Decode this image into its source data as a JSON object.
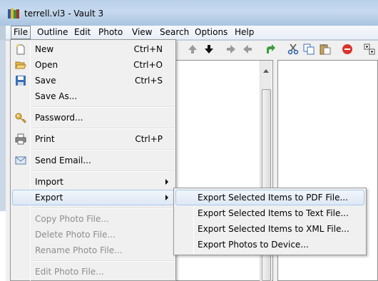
{
  "window": {
    "title": "terrell.vl3 - Vault 3"
  },
  "menubar": {
    "items": [
      "File",
      "Outline",
      "Edit",
      "Photo",
      "View",
      "Search",
      "Options",
      "Help"
    ]
  },
  "file_menu": {
    "items": [
      {
        "label": "New",
        "shortcut": "Ctrl+N",
        "icon": "new-file-icon"
      },
      {
        "label": "Open",
        "shortcut": "Ctrl+O",
        "icon": "open-folder-icon"
      },
      {
        "label": "Save",
        "shortcut": "Ctrl+S",
        "icon": "save-disk-icon"
      },
      {
        "label": "Save As...",
        "shortcut": ""
      },
      {
        "label": "Password...",
        "shortcut": "",
        "icon": "key-icon"
      },
      {
        "label": "Print",
        "shortcut": "Ctrl+P",
        "icon": "printer-icon"
      },
      {
        "label": "Send Email...",
        "shortcut": "",
        "icon": "email-icon"
      },
      {
        "label": "Import",
        "shortcut": "",
        "submenu": true
      },
      {
        "label": "Export",
        "shortcut": "",
        "submenu": true,
        "highlighted": true
      },
      {
        "label": "Copy Photo File...",
        "shortcut": "",
        "disabled": true
      },
      {
        "label": "Delete Photo File...",
        "shortcut": "",
        "disabled": true
      },
      {
        "label": "Rename Photo File...",
        "shortcut": "",
        "disabled": true
      },
      {
        "label": "Edit Photo File...",
        "shortcut": "",
        "disabled": true
      }
    ]
  },
  "export_menu": {
    "items": [
      {
        "label": "Export Selected Items to PDF File...",
        "highlighted": true
      },
      {
        "label": "Export Selected Items to Text File..."
      },
      {
        "label": "Export Selected Items to XML File..."
      },
      {
        "label": "Export Photos to Device..."
      }
    ]
  },
  "colors": {
    "highlight_border": "#a8c8ec",
    "disabled_text": "#8d8d8d",
    "delete_red": "#d9342b",
    "redo_green": "#3a9d3a"
  }
}
